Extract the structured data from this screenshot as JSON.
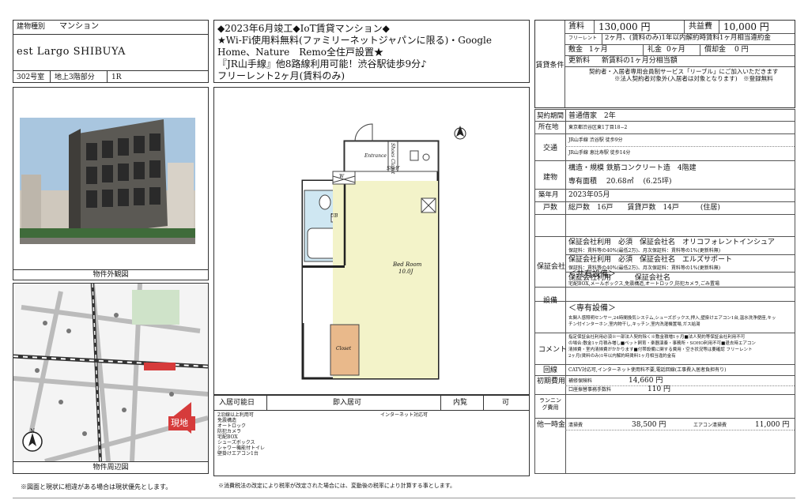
{
  "building": {
    "type_label": "建物種別",
    "type_value": "マンション",
    "name": "est Largo SHIBUYA",
    "room": "302号室",
    "floor": "地上3階部分",
    "layout": "1R"
  },
  "headline": {
    "line1": "◆2023年6月竣工◆IoT賃貸マンション◆",
    "line2": "★Wi-Fi使用料無料(ファミリーネットジャパンに限る)・Google",
    "line3": "Home、Nature　Remo全住戸設置★",
    "line4": "『JR山手線』他8路線利用可能！渋谷駅徒歩9分♪",
    "line5": "フリーレント2ヶ月(賃料のみ)"
  },
  "captions": {
    "exterior": "物件外観図",
    "map": "物件周辺図",
    "note": "※図面と現状に相違がある場合は現状優先とします。",
    "tax_note": "※消費税法の改定により税率が改定された場合には、変動後の税率により計算する事とします。"
  },
  "floorplan": {
    "entrance": "Entrance",
    "shoes": "Shoes Closet",
    "shelf": "Shelf",
    "wc": "W",
    "ub": "UB",
    "room": "Bed Room",
    "room_size": "10.0J",
    "closet": "Closet"
  },
  "map": {
    "here": "現地",
    "compass": "N"
  },
  "move_in": {
    "label": "入居可能日",
    "value": "即入居可",
    "viewing_label": "内覧",
    "viewing_value": "可",
    "internet": "インターネット対応可",
    "features": [
      "2沿線以上利用可",
      "免震構造",
      "オートロック",
      "防犯カメラ",
      "宅配BOX",
      "シューズボックス",
      "シャワー機能付トイレ",
      "壁掛けエアコン1台"
    ]
  },
  "rent": {
    "section_label": "賃貸条件",
    "rent_label": "賃料",
    "rent_value": "130,000 円",
    "fee_label": "共益費",
    "fee_value": "10,000 円",
    "freerent_label": "フリーレント",
    "freerent_value": "2ヶ月、(賃料のみ)1年以内解約時賃料1ヶ月相当違約金",
    "deposit_label": "敷金",
    "deposit_value": "1ヶ月",
    "key_label": "礼金",
    "key_value": "0ヶ月",
    "amort_label": "償却金",
    "amort_value": "0 円",
    "renewal_label": "更新料",
    "renewal_value": "新賃料の1ヶ月分相当額",
    "note1": "契約者・入居者専用会員制サービス「リーブル」にご加入いただきます",
    "note2": "※法人契約者対象外(入居者は対象となります)　※登録無料"
  },
  "details": {
    "contract_label": "契約期間",
    "contract_value": "普通借家　2年",
    "address_label": "所在地",
    "address_value": "東京都渋谷区東1丁目18−2",
    "transit_label": "交通",
    "transit1": "JR山手線 渋谷駅 徒歩9分",
    "transit2": "JR山手線 恵比寿駅 徒歩14分",
    "building_label": "建物",
    "structure": "構造・規模 鉄筋コンクリート造　4階建",
    "area": "専有面積　 20.68㎡　 (6.25坪)",
    "built_label": "築年月",
    "built_value": "2023年05月",
    "units_label": "戸数",
    "units_value": "総戸数　16戸　　賃貸戸数　14戸　　　(住居)",
    "guarantee_label": "保証会社",
    "g1": "保証会社利用　必須　保証会社名　オリコフォレントインシュア",
    "g1_note": "保証料：賃料等の40%(最低2万)、月次保証料：賃料等の1%(更新料無)",
    "g2": "保証会社利用　必須　保証会社名　エルズサポート",
    "g2_note": "保証料：賃料等の40%(最低2万)、月次保証料：賃料等の1%(更新料無)",
    "g3": "保証会社利用　　　 保証会社名",
    "facility_label": "設備",
    "common_title": "＜共有設備＞",
    "common_value": "宅配BOX,メールボックス,免震構造,オートロック,防犯カメラ,ごみ置場",
    "private_title": "＜専有設備＞",
    "private_value1": "玄関人感照明センサー,24時間換気システム,シューズボックス,押入,壁掛けエアコン1台,温水洗浄便座,キッ",
    "private_value2": "チン付インターホン,室内物干し,キッチン,室内洗濯機置場,ガス給湯",
    "comment_label": "コメント",
    "comment1": "指定保証会社利用必須※一部法人契約除く※敷金積増1ヶ月■法人契約等保証会社利用不可",
    "comment2": "の場合:敷金1ヶ月積み増し■ペット飼育・楽器演奏・事務所・SOHO利用不可■退去時エアコン",
    "comment3": "清掃費・室内清掃費がかかります■付帯設備に関する費用・空き状況等は要確認 フリーレント",
    "comment4": "2ヶ月(賃料のみ)1年以内解約時賃料1ヶ月相当違約金有",
    "line_label": "回線",
    "line_value": "CATV対応可,インターネット使用料不要,電話回線(工事費入居者負担有り)",
    "initial_label": "初期費用",
    "init1_name": "補修保険料",
    "init1_value": "14,660 円",
    "init2_name": "口座振替事務手数料",
    "init2_value": "110 円",
    "running_label": "ランニング費用",
    "onetime_label": "他一時金",
    "one1_name": "清掃費",
    "one1_value": "38,500 円",
    "one2_name": "エアコン清掃費",
    "one2_value": "11,000 円"
  }
}
